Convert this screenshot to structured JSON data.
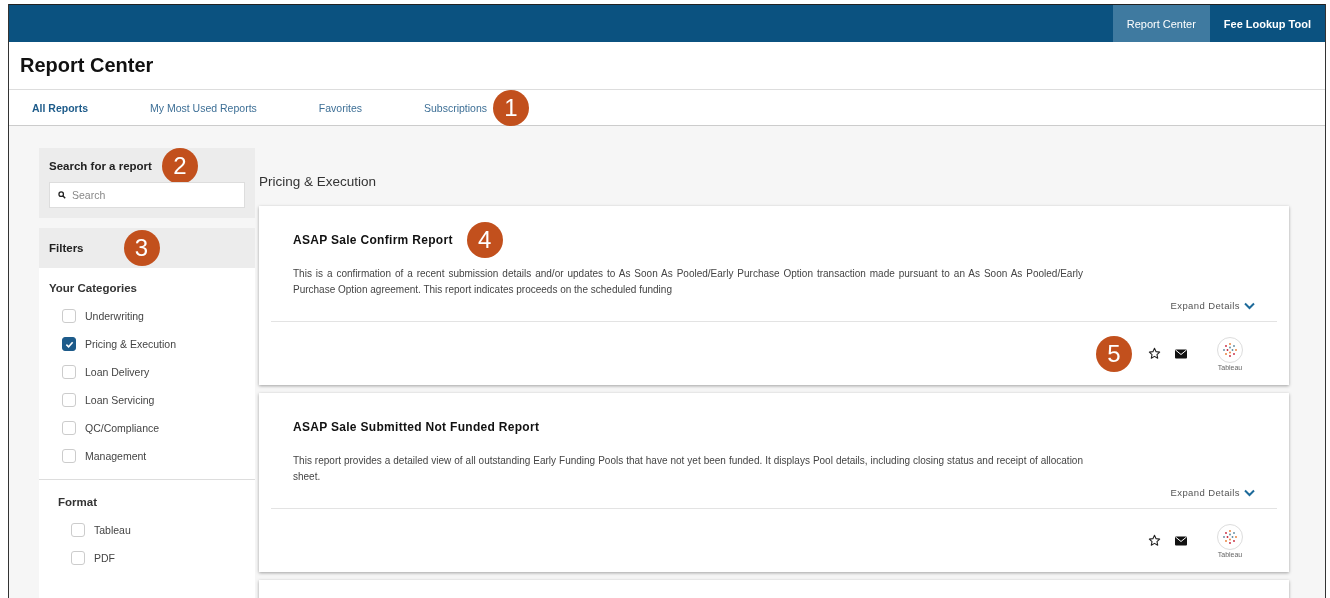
{
  "top_nav": {
    "items": [
      {
        "label": "Report Center",
        "selected": true
      },
      {
        "label": "Fee Lookup Tool",
        "selected": false
      }
    ]
  },
  "page_title": "Report Center",
  "tabs": {
    "items": [
      {
        "label": "All Reports",
        "selected": true
      },
      {
        "label": "My Most Used Reports",
        "selected": false
      },
      {
        "label": "Favorites",
        "selected": false
      },
      {
        "label": "Subscriptions",
        "selected": false
      }
    ],
    "callout": "1"
  },
  "search": {
    "title": "Search for a report",
    "placeholder": "Search",
    "callout": "2"
  },
  "filters": {
    "title": "Filters",
    "callout": "3",
    "groups": [
      {
        "title": "Your Categories",
        "options": [
          {
            "label": "Underwriting",
            "checked": false
          },
          {
            "label": "Pricing & Execution",
            "checked": true
          },
          {
            "label": "Loan Delivery",
            "checked": false
          },
          {
            "label": "Loan Servicing",
            "checked": false
          },
          {
            "label": "QC/Compliance",
            "checked": false
          },
          {
            "label": "Management",
            "checked": false
          }
        ]
      },
      {
        "title": "Format",
        "options": [
          {
            "label": "Tableau",
            "checked": false
          },
          {
            "label": "PDF",
            "checked": false
          }
        ]
      }
    ]
  },
  "section_title": "Pricing & Execution",
  "reports": [
    {
      "title": "ASAP Sale Confirm Report",
      "title_callout": "4",
      "description": "This is a confirmation of a recent submission details and/or updates to As Soon As Pooled/Early Purchase Option transaction made pursuant to an As Soon As Pooled/Early Purchase Option agreement. This report indicates proceeds on the scheduled funding",
      "expand_label": "Expand Details",
      "actions_callout": "5",
      "format_label": "Tableau"
    },
    {
      "title": "ASAP Sale Submitted Not Funded Report",
      "description": "This report provides a detailed view of all outstanding Early Funding Pools that have not yet been funded. It displays Pool details, including closing status and receipt of allocation sheet.",
      "expand_label": "Expand Details",
      "format_label": "Tableau"
    }
  ]
}
